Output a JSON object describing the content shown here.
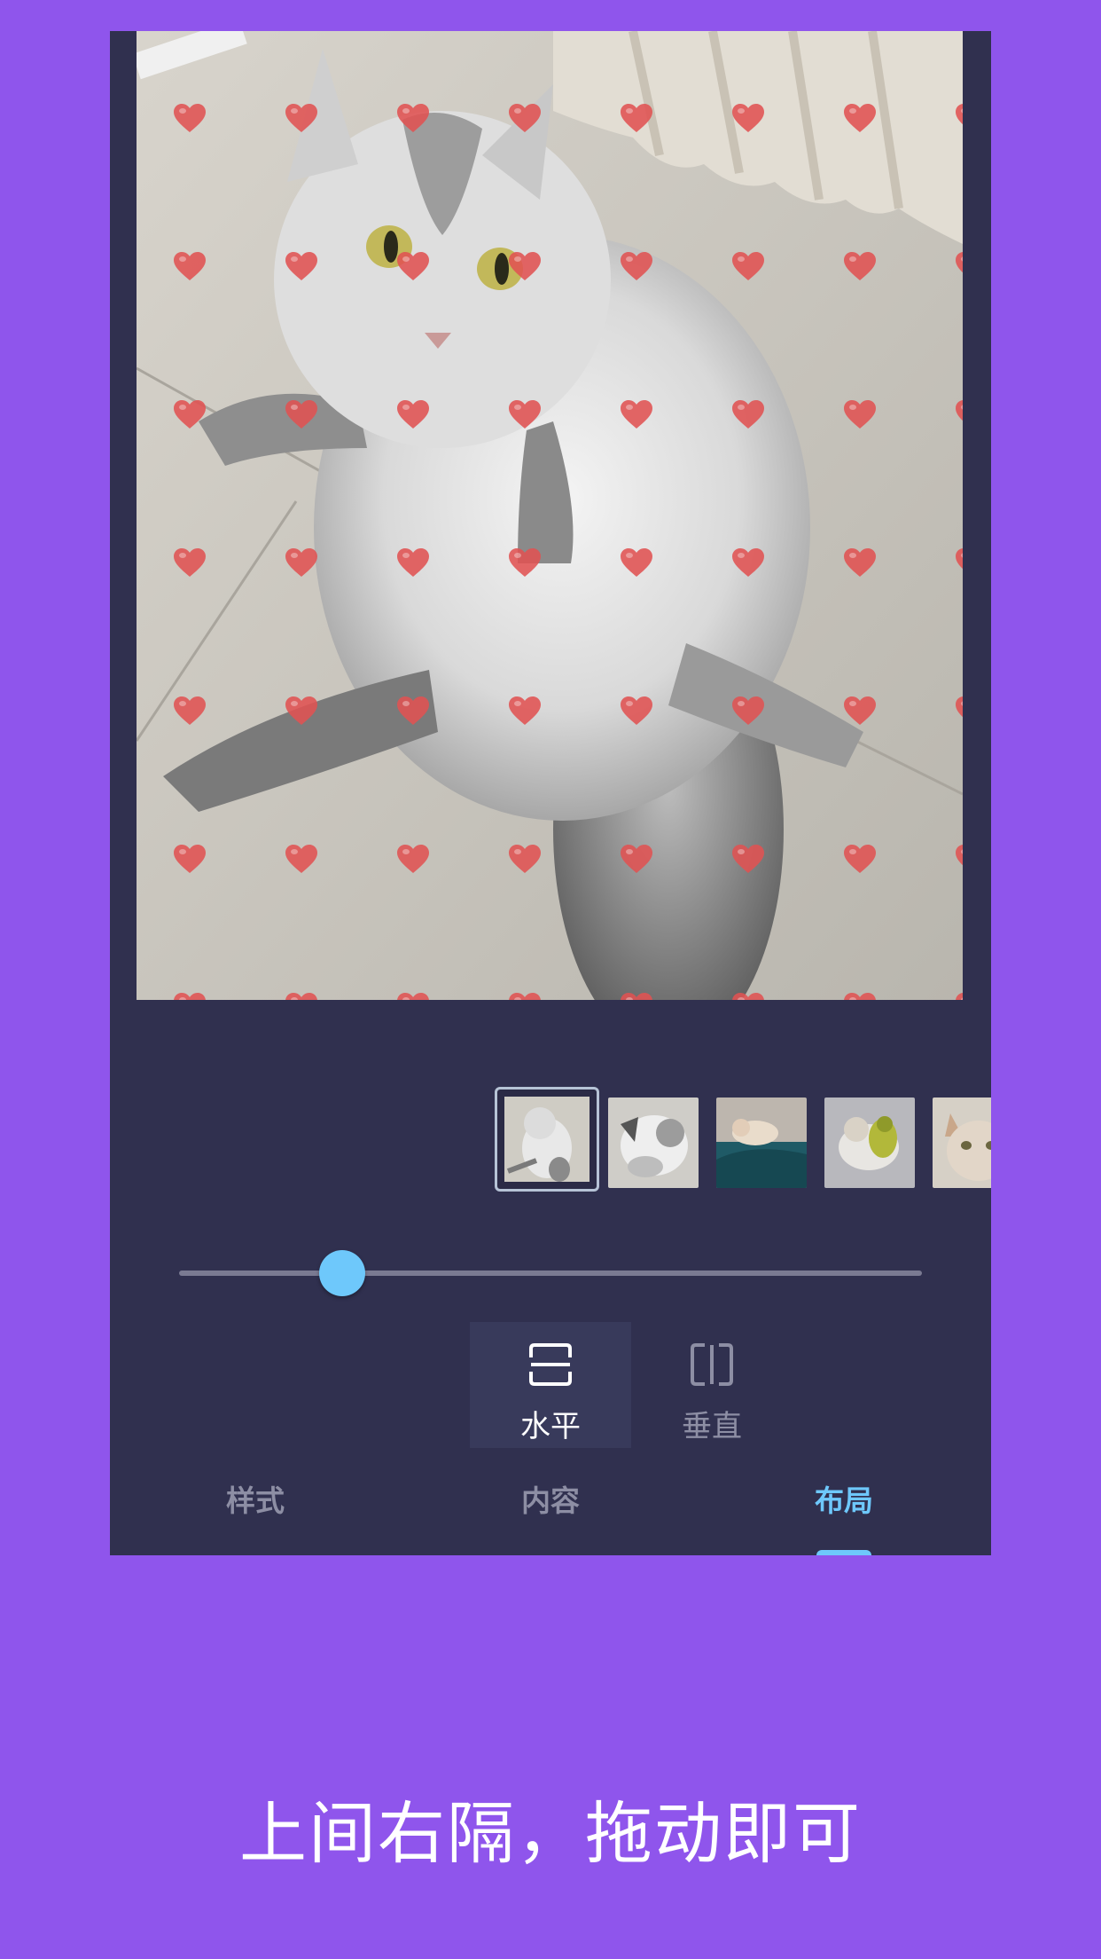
{
  "colors": {
    "page_background": "#8f55ec",
    "panel_background": "#30304f",
    "accent": "#6ec8fb",
    "heart": "#e05252",
    "inactive_text": "#8d8ea4"
  },
  "overlay": {
    "pattern_icon": "heart-icon"
  },
  "thumbnails": [
    {
      "name": "thumbnail-1",
      "selected": true
    },
    {
      "name": "thumbnail-2",
      "selected": false
    },
    {
      "name": "thumbnail-3",
      "selected": false
    },
    {
      "name": "thumbnail-4",
      "selected": false
    },
    {
      "name": "thumbnail-5",
      "selected": false
    }
  ],
  "slider": {
    "value": 0.22
  },
  "orientation": {
    "horizontal_label": "水平",
    "vertical_label": "垂直",
    "selected": "horizontal"
  },
  "tabs": [
    {
      "label": "样式",
      "active": false
    },
    {
      "label": "内容",
      "active": false
    },
    {
      "label": "布局",
      "active": true
    }
  ],
  "caption": "上间右隔，拖动即可"
}
